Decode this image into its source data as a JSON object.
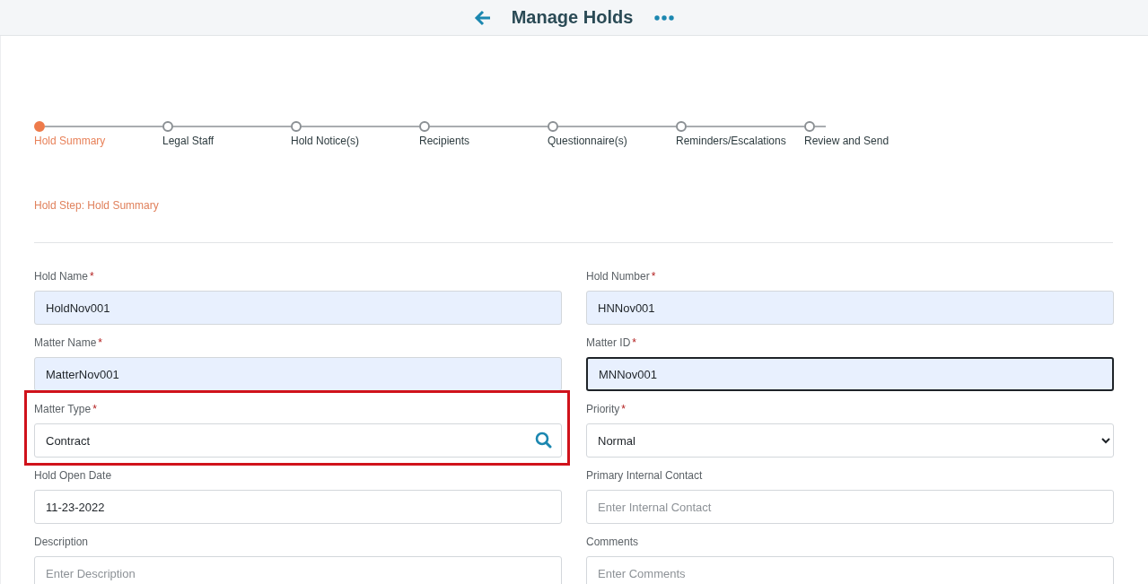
{
  "header": {
    "title": "Manage Holds"
  },
  "steps": [
    {
      "label": "Hold Summary",
      "selected": true
    },
    {
      "label": "Legal Staff",
      "selected": false
    },
    {
      "label": "Hold Notice(s)",
      "selected": false
    },
    {
      "label": "Recipients",
      "selected": false
    },
    {
      "label": "Questionnaire(s)",
      "selected": false
    },
    {
      "label": "Reminders/Escalations",
      "selected": false
    },
    {
      "label": "Review and Send",
      "selected": false
    }
  ],
  "step_caption": "Hold Step: Hold Summary",
  "fields": [
    {
      "kind": "text",
      "label": "Hold Name",
      "required_mark": "*",
      "value": "HoldNov001",
      "autofilled": true,
      "focused": false,
      "highlighted": false
    },
    {
      "kind": "text",
      "label": "Hold Number",
      "required_mark": "*",
      "value": "HNNov001",
      "autofilled": true,
      "focused": false,
      "highlighted": false
    },
    {
      "kind": "text",
      "label": "Matter Name",
      "required_mark": "*",
      "value": "MatterNov001",
      "autofilled": true,
      "focused": false,
      "highlighted": false
    },
    {
      "kind": "text",
      "label": "Matter ID",
      "required_mark": "*",
      "value": "MNNov001",
      "autofilled": true,
      "focused": true,
      "highlighted": false
    },
    {
      "kind": "search",
      "label": "Matter Type",
      "required_mark": "*",
      "value": "Contract",
      "autofilled": false,
      "focused": false,
      "highlighted": true
    },
    {
      "kind": "select",
      "label": "Priority",
      "required_mark": "*",
      "value": "Normal",
      "autofilled": false,
      "focused": false,
      "highlighted": false
    },
    {
      "kind": "text",
      "label": "Hold Open Date",
      "value": "11-23-2022",
      "autofilled": false,
      "focused": false,
      "highlighted": false
    },
    {
      "kind": "text",
      "label": "Primary Internal Contact",
      "placeholder": "Enter Internal Contact",
      "autofilled": false,
      "focused": false,
      "highlighted": false
    },
    {
      "kind": "text",
      "label": "Description",
      "placeholder": "Enter Description",
      "autofilled": false,
      "focused": false,
      "highlighted": false
    },
    {
      "kind": "text",
      "label": "Comments",
      "placeholder": "Enter Comments",
      "autofilled": false,
      "focused": false,
      "highlighted": false
    }
  ]
}
